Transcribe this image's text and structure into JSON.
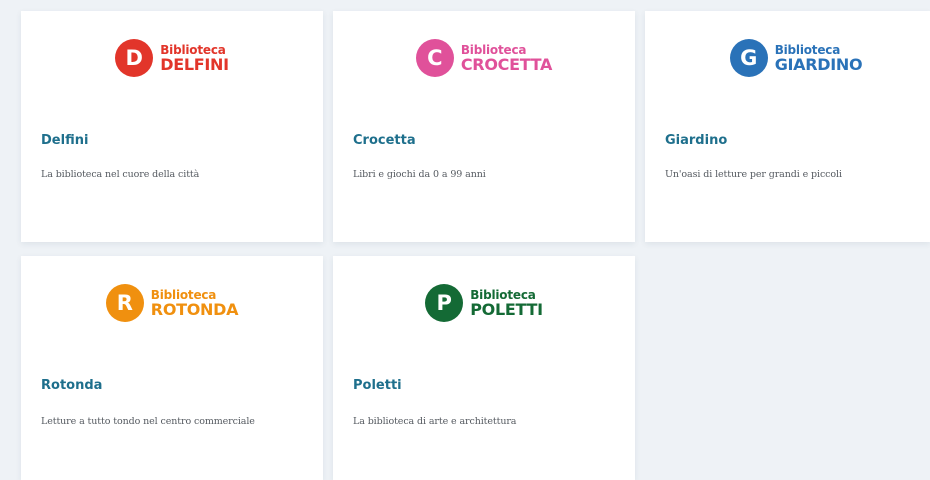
{
  "libraries": [
    {
      "logo_letter": "D",
      "logo_word": "Biblioteca",
      "logo_name": "DELFINI",
      "color": "#e2352a",
      "title": "Delfini",
      "description": "La biblioteca nel cuore della città"
    },
    {
      "logo_letter": "C",
      "logo_word": "Biblioteca",
      "logo_name": "CROCETTA",
      "color": "#e0519a",
      "title": "Crocetta",
      "description": "Libri e giochi da 0 a 99 anni"
    },
    {
      "logo_letter": "G",
      "logo_word": "Biblioteca",
      "logo_name": "GIARDINO",
      "color": "#2a72b8",
      "title": "Giardino",
      "description": "Un'oasi di letture per grandi e piccoli"
    },
    {
      "logo_letter": "R",
      "logo_word": "Biblioteca",
      "logo_name": "ROTONDA",
      "color": "#f0900f",
      "title": "Rotonda",
      "description": "Letture a tutto tondo nel centro commerciale"
    },
    {
      "logo_letter": "P",
      "logo_word": "Biblioteca",
      "logo_name": "POLETTI",
      "color": "#146a35",
      "title": "Poletti",
      "description": "La biblioteca di arte e architettura"
    }
  ],
  "theme": {
    "title_color": "#1e6f8c",
    "background": "#eef2f6"
  }
}
